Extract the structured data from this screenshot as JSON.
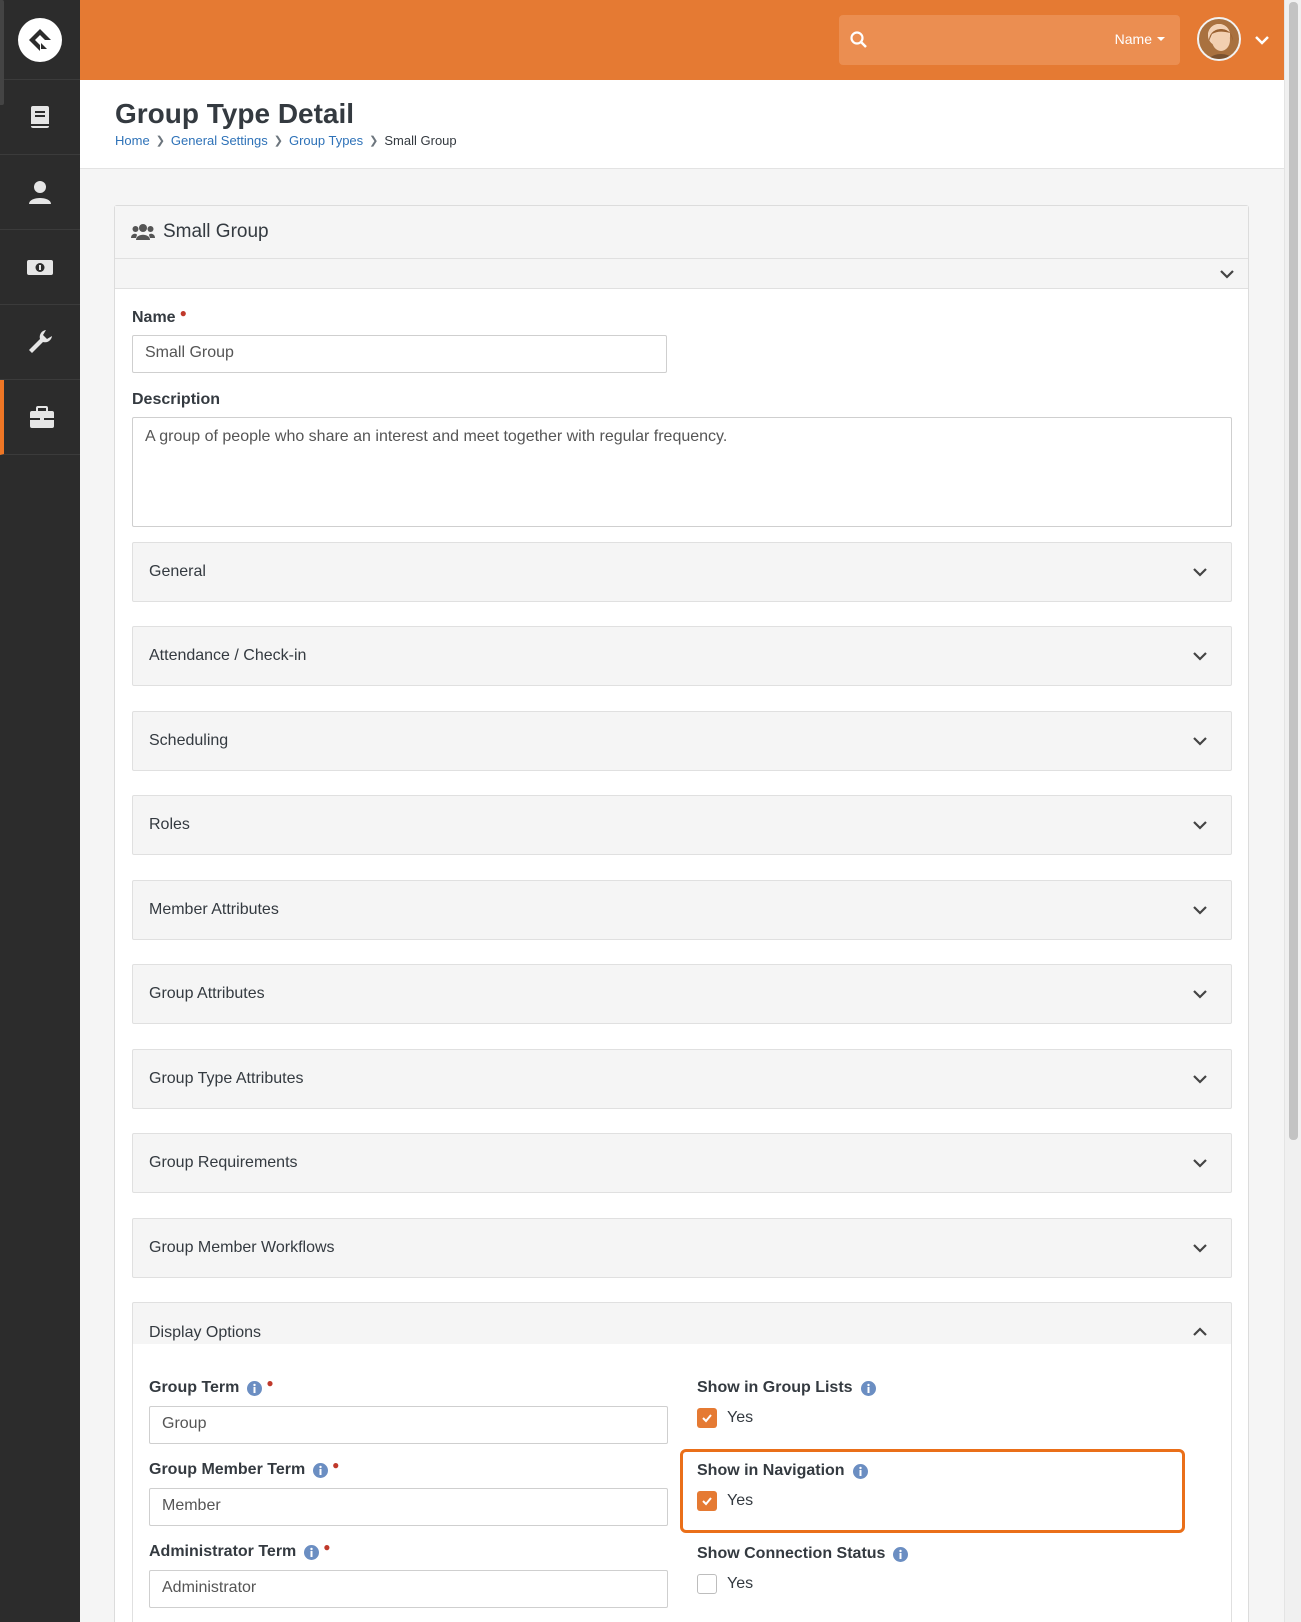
{
  "topbar": {
    "search_filter": "Name"
  },
  "page": {
    "title": "Group Type Detail",
    "breadcrumb": [
      "Home",
      "General Settings",
      "Group Types",
      "Small Group"
    ]
  },
  "panel": {
    "title": "Small Group"
  },
  "form": {
    "name_label": "Name",
    "name_value": "Small Group",
    "description_label": "Description",
    "description_value": "A group of people who share an interest and meet together with regular frequency."
  },
  "sections": [
    "General",
    "Attendance / Check-in",
    "Scheduling",
    "Roles",
    "Member Attributes",
    "Group Attributes",
    "Group Type Attributes",
    "Group Requirements",
    "Group Member Workflows",
    "Display Options"
  ],
  "display_options": {
    "group_term_label": "Group Term",
    "group_term_value": "Group",
    "group_member_term_label": "Group Member Term",
    "group_member_term_value": "Member",
    "administrator_term_label": "Administrator Term",
    "administrator_term_value": "Administrator",
    "show_in_group_lists_label": "Show in Group Lists",
    "show_in_group_lists_checked": true,
    "show_in_navigation_label": "Show in Navigation",
    "show_in_navigation_checked": true,
    "show_connection_status_label": "Show Connection Status",
    "show_connection_status_checked": false,
    "yes_label": "Yes"
  },
  "colors": {
    "brand": "#e57a33",
    "highlight": "#ea6f19",
    "link": "#2e72b8",
    "info": "#6b8ec2"
  }
}
